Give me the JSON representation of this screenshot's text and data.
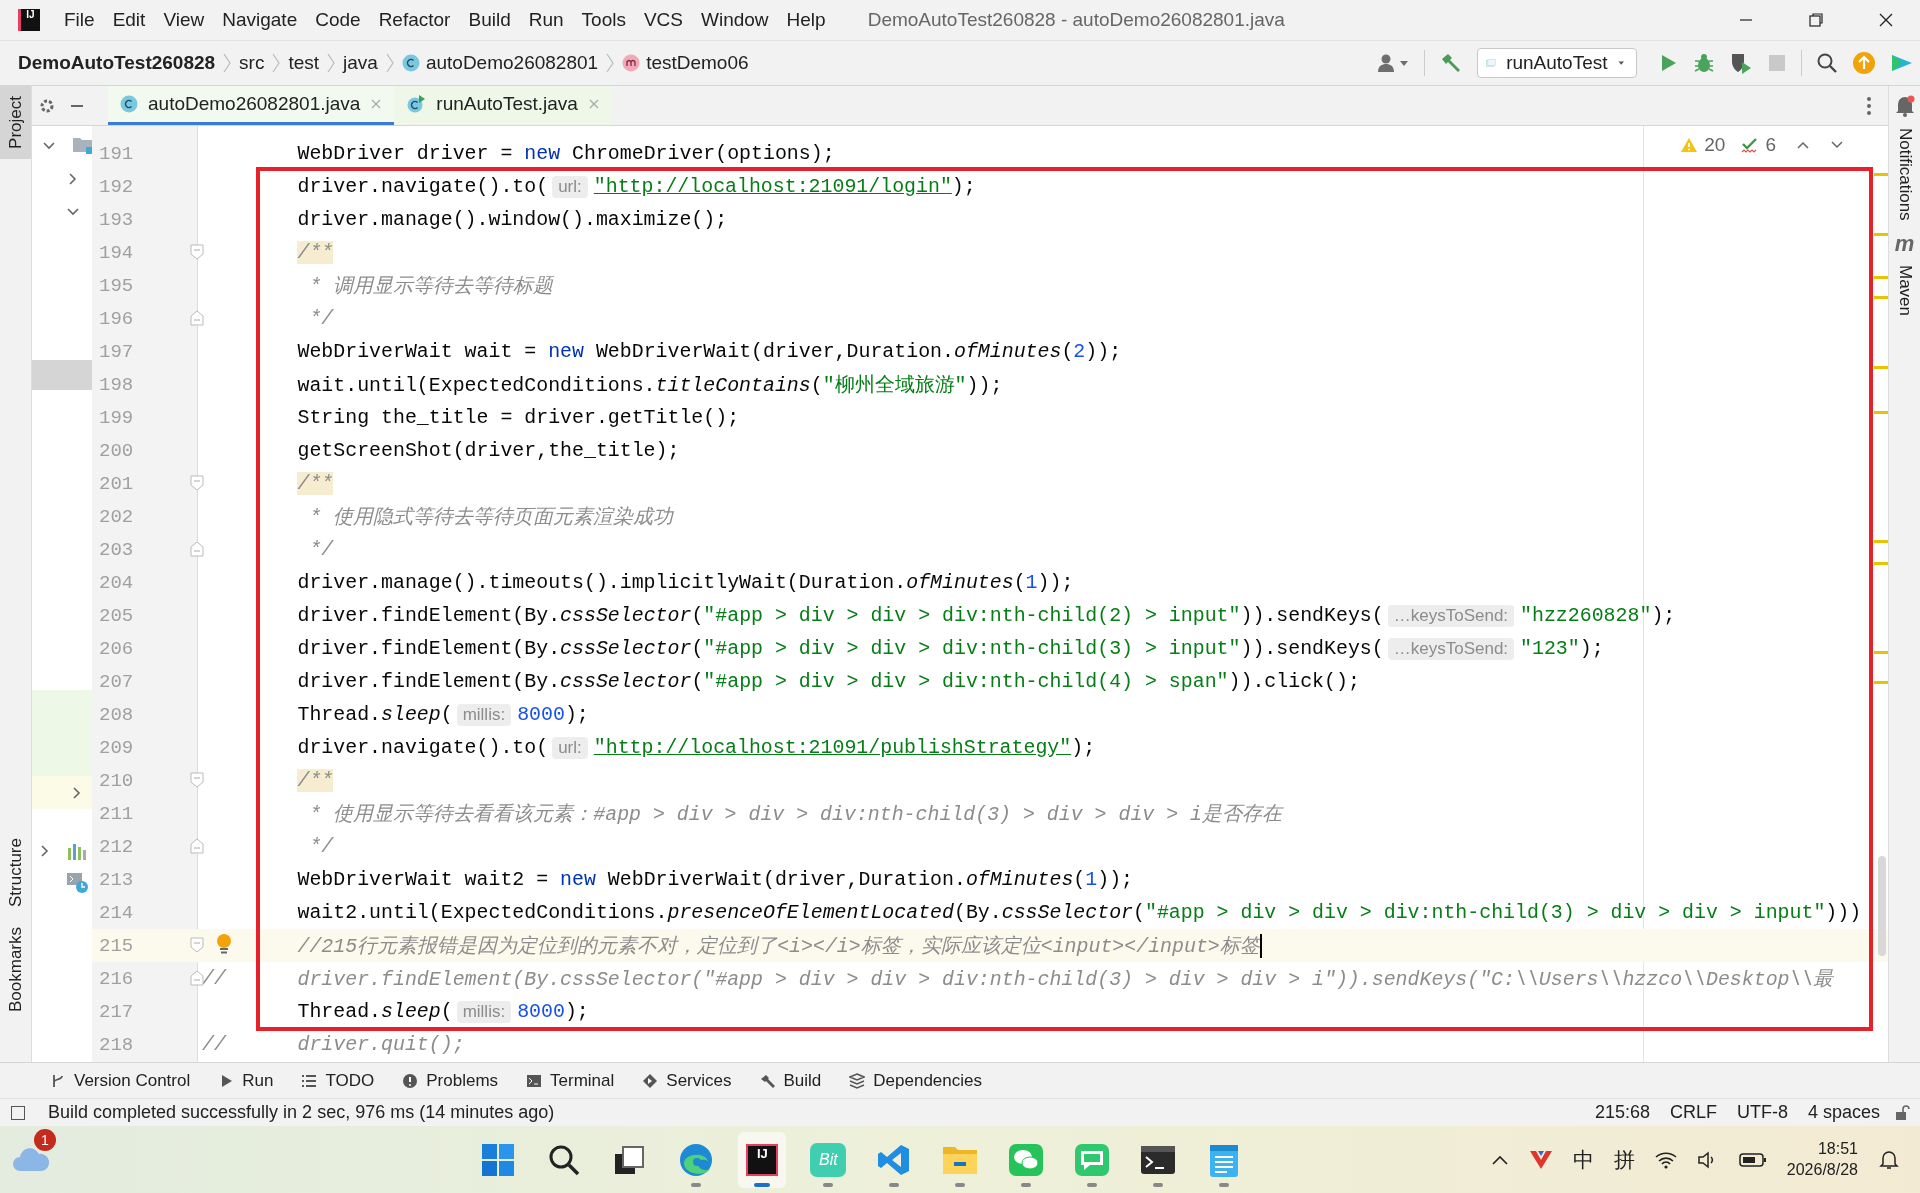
{
  "window": {
    "logo_text": "IJ",
    "title": "DemoAutoTest260828 - autoDemo26082801.java"
  },
  "menu": [
    "File",
    "Edit",
    "View",
    "Navigate",
    "Code",
    "Refactor",
    "Build",
    "Run",
    "Tools",
    "VCS",
    "Window",
    "Help"
  ],
  "breadcrumbs": [
    {
      "label": "DemoAutoTest260828",
      "kind": "project"
    },
    {
      "label": "src",
      "kind": "folder"
    },
    {
      "label": "test",
      "kind": "folder"
    },
    {
      "label": "java",
      "kind": "folder"
    },
    {
      "label": "autoDemo26082801",
      "kind": "class"
    },
    {
      "label": "testDemo06",
      "kind": "method"
    }
  ],
  "run_config": {
    "label": "runAutoTest"
  },
  "side_tabs_left": [
    {
      "label": "Project",
      "selected": true
    },
    {
      "label": "Structure",
      "selected": false
    },
    {
      "label": "Bookmarks",
      "selected": false
    }
  ],
  "side_tabs_right": [
    {
      "label": "Notifications"
    },
    {
      "label": "Maven",
      "icon_text": "m"
    }
  ],
  "project_tree": [
    {
      "expanded": true
    },
    {
      "expanded": false
    },
    {
      "expanded": true
    }
  ],
  "tabs": [
    {
      "label": "autoDemo26082801.java",
      "selected": true,
      "kind": "class"
    },
    {
      "label": "runAutoTest.java",
      "selected": false,
      "kind": "runnable"
    }
  ],
  "inspections": {
    "warnings": "20",
    "weak_warnings": "6"
  },
  "editor": {
    "lines": [
      {
        "number": "191",
        "segments": [
          {
            "kind": "plain",
            "text": "WebDriver driver = "
          },
          {
            "kind": "keyword",
            "text": "new"
          },
          {
            "kind": "plain",
            "text": " ChromeDriver(options);"
          }
        ]
      },
      {
        "number": "192",
        "segments": [
          {
            "kind": "plain",
            "text": "driver.navigate().to("
          },
          {
            "kind": "hint",
            "text": "url:"
          },
          {
            "kind": "link",
            "text": "\"http://localhost:21091/login\""
          },
          {
            "kind": "plain",
            "text": ");"
          }
        ]
      },
      {
        "number": "193",
        "segments": [
          {
            "kind": "plain",
            "text": "driver.manage().window().maximize();"
          }
        ]
      },
      {
        "number": "194",
        "fold_start": true,
        "segments": [
          {
            "kind": "doc-warn",
            "text": "/**"
          }
        ]
      },
      {
        "number": "195",
        "segments": [
          {
            "kind": "doc",
            "text": " * 调用显示等待去等待标题"
          }
        ]
      },
      {
        "number": "196",
        "fold_end": true,
        "segments": [
          {
            "kind": "doc",
            "text": " */"
          }
        ]
      },
      {
        "number": "197",
        "segments": [
          {
            "kind": "plain",
            "text": "WebDriverWait wait = "
          },
          {
            "kind": "keyword",
            "text": "new"
          },
          {
            "kind": "plain",
            "text": " WebDriverWait(driver,Duration."
          },
          {
            "kind": "method",
            "text": "ofMinutes"
          },
          {
            "kind": "plain",
            "text": "("
          },
          {
            "kind": "number",
            "text": "2"
          },
          {
            "kind": "plain",
            "text": "));"
          }
        ]
      },
      {
        "number": "198",
        "segments": [
          {
            "kind": "plain",
            "text": "wait.until(ExpectedConditions."
          },
          {
            "kind": "method",
            "text": "titleContains"
          },
          {
            "kind": "plain",
            "text": "("
          },
          {
            "kind": "string",
            "text": "\"柳州全域旅游\""
          },
          {
            "kind": "plain",
            "text": "));"
          }
        ]
      },
      {
        "number": "199",
        "segments": [
          {
            "kind": "plain",
            "text": "String the_title = driver.getTitle();"
          }
        ]
      },
      {
        "number": "200",
        "segments": [
          {
            "kind": "plain",
            "text": "getScreenShot(driver,the_title);"
          }
        ]
      },
      {
        "number": "201",
        "fold_start": true,
        "segments": [
          {
            "kind": "doc-warn",
            "text": "/**"
          }
        ]
      },
      {
        "number": "202",
        "segments": [
          {
            "kind": "doc",
            "text": " * 使用隐式等待去等待页面元素渲染成功"
          }
        ]
      },
      {
        "number": "203",
        "fold_end": true,
        "segments": [
          {
            "kind": "doc",
            "text": " */"
          }
        ]
      },
      {
        "number": "204",
        "segments": [
          {
            "kind": "plain",
            "text": "driver.manage().timeouts().implicitlyWait(Duration."
          },
          {
            "kind": "method",
            "text": "ofMinutes"
          },
          {
            "kind": "plain",
            "text": "("
          },
          {
            "kind": "number",
            "text": "1"
          },
          {
            "kind": "plain",
            "text": "));"
          }
        ]
      },
      {
        "number": "205",
        "segments": [
          {
            "kind": "plain",
            "text": "driver.findElement(By."
          },
          {
            "kind": "method",
            "text": "cssSelector"
          },
          {
            "kind": "plain",
            "text": "("
          },
          {
            "kind": "string",
            "text": "\"#app > div > div > div:nth-child(2) > input\""
          },
          {
            "kind": "plain",
            "text": ")).sendKeys("
          },
          {
            "kind": "hint",
            "text": "…keysToSend:"
          },
          {
            "kind": "string",
            "text": "\"hzz260828\""
          },
          {
            "kind": "plain",
            "text": ");"
          }
        ]
      },
      {
        "number": "206",
        "segments": [
          {
            "kind": "plain",
            "text": "driver.findElement(By."
          },
          {
            "kind": "method",
            "text": "cssSelector"
          },
          {
            "kind": "plain",
            "text": "("
          },
          {
            "kind": "string",
            "text": "\"#app > div > div > div:nth-child(3) > input\""
          },
          {
            "kind": "plain",
            "text": ")).sendKeys("
          },
          {
            "kind": "hint",
            "text": "…keysToSend:"
          },
          {
            "kind": "string",
            "text": "\"123\""
          },
          {
            "kind": "plain",
            "text": ");"
          }
        ]
      },
      {
        "number": "207",
        "segments": [
          {
            "kind": "plain",
            "text": "driver.findElement(By."
          },
          {
            "kind": "method",
            "text": "cssSelector"
          },
          {
            "kind": "plain",
            "text": "("
          },
          {
            "kind": "string",
            "text": "\"#app > div > div > div:nth-child(4) > span\""
          },
          {
            "kind": "plain",
            "text": ")).click();"
          }
        ]
      },
      {
        "number": "208",
        "segments": [
          {
            "kind": "plain",
            "text": "Thread."
          },
          {
            "kind": "method",
            "text": "sleep"
          },
          {
            "kind": "plain",
            "text": "("
          },
          {
            "kind": "hint",
            "text": "millis:"
          },
          {
            "kind": "number",
            "text": "8000"
          },
          {
            "kind": "plain",
            "text": ");"
          }
        ]
      },
      {
        "number": "209",
        "segments": [
          {
            "kind": "plain",
            "text": "driver.navigate().to("
          },
          {
            "kind": "hint",
            "text": "url:"
          },
          {
            "kind": "link",
            "text": "\"http://localhost:21091/publishStrategy\""
          },
          {
            "kind": "plain",
            "text": ");"
          }
        ]
      },
      {
        "number": "210",
        "fold_start": true,
        "segments": [
          {
            "kind": "doc-warn",
            "text": "/**"
          }
        ]
      },
      {
        "number": "211",
        "segments": [
          {
            "kind": "doc",
            "text": " * 使用显示等待去看看该元素：#app > div > div > div:nth-child(3) > div > div > i是否存在"
          }
        ]
      },
      {
        "number": "212",
        "fold_end": true,
        "segments": [
          {
            "kind": "doc",
            "text": " */"
          }
        ]
      },
      {
        "number": "213",
        "segments": [
          {
            "kind": "plain",
            "text": "WebDriverWait wait2 = "
          },
          {
            "kind": "keyword",
            "text": "new"
          },
          {
            "kind": "plain",
            "text": " WebDriverWait(driver,Duration."
          },
          {
            "kind": "method",
            "text": "ofMinutes"
          },
          {
            "kind": "plain",
            "text": "("
          },
          {
            "kind": "number",
            "text": "1"
          },
          {
            "kind": "plain",
            "text": "));"
          }
        ]
      },
      {
        "number": "214",
        "segments": [
          {
            "kind": "plain",
            "text": "wait2.until(ExpectedConditions."
          },
          {
            "kind": "method",
            "text": "presenceOfElementLocated"
          },
          {
            "kind": "plain",
            "text": "(By."
          },
          {
            "kind": "method",
            "text": "cssSelector"
          },
          {
            "kind": "plain",
            "text": "("
          },
          {
            "kind": "string",
            "text": "\"#app > div > div > div:nth-child(3) > div > div > input\""
          },
          {
            "kind": "plain",
            "text": ")))"
          }
        ]
      },
      {
        "number": "215",
        "fold_start": true,
        "current": true,
        "intention": true,
        "segments": [
          {
            "kind": "comment",
            "text": "//215行元素报错是因为定位到的元素不对，定位到了<i></i>标签，实际应该定位<input></input>标签"
          }
        ]
      },
      {
        "number": "216",
        "fold_end": true,
        "prefix": "//",
        "segments": [
          {
            "kind": "comment",
            "text": "driver.findElement(By.cssSelector(\"#app > div > div > div:nth-child(3) > div > div > i\")).sendKeys(\"C:\\\\Users\\\\hzzco\\\\Desktop\\\\最"
          }
        ]
      },
      {
        "number": "217",
        "segments": [
          {
            "kind": "plain",
            "text": "Thread."
          },
          {
            "kind": "method",
            "text": "sleep"
          },
          {
            "kind": "plain",
            "text": "("
          },
          {
            "kind": "hint",
            "text": "millis:"
          },
          {
            "kind": "number",
            "text": "8000"
          },
          {
            "kind": "plain",
            "text": ");"
          }
        ]
      },
      {
        "number": "218",
        "prefix": "//",
        "segments": [
          {
            "kind": "comment",
            "text": "driver.quit();"
          }
        ]
      }
    ]
  },
  "tool_windows": [
    {
      "label": "Version Control",
      "kind": "vcs"
    },
    {
      "label": "Run",
      "kind": "run"
    },
    {
      "label": "TODO",
      "kind": "todo"
    },
    {
      "label": "Problems",
      "kind": "problems"
    },
    {
      "label": "Terminal",
      "kind": "terminal"
    },
    {
      "label": "Services",
      "kind": "services"
    },
    {
      "label": "Build",
      "kind": "build"
    },
    {
      "label": "Dependencies",
      "kind": "dependencies"
    }
  ],
  "status_bar": {
    "message": "Build completed successfully in 2 sec, 976 ms (14 minutes ago)",
    "position": "215:68",
    "line_ending": "CRLF",
    "encoding": "UTF-8",
    "indent": "4 spaces"
  },
  "taskbar": {
    "weather_badge": "1",
    "apps": [
      {
        "kind": "start",
        "running": false,
        "selected": false
      },
      {
        "kind": "search",
        "running": false,
        "selected": false
      },
      {
        "kind": "taskview",
        "running": false,
        "selected": false
      },
      {
        "kind": "edge",
        "running": true,
        "selected": false
      },
      {
        "kind": "ide",
        "label": "IJ",
        "running": true,
        "selected": true
      },
      {
        "kind": "bit",
        "label": "Bit",
        "running": true,
        "selected": false
      },
      {
        "kind": "vscode",
        "running": true,
        "selected": false
      },
      {
        "kind": "explorer",
        "running": true,
        "selected": false
      },
      {
        "kind": "wechat",
        "running": true,
        "selected": false
      },
      {
        "kind": "chat",
        "running": true,
        "selected": false
      },
      {
        "kind": "terminal",
        "running": true,
        "selected": false
      },
      {
        "kind": "notepad",
        "running": true,
        "selected": false
      }
    ],
    "ime": [
      "中",
      "拼"
    ],
    "time": "18:51",
    "date": "2026/8/28"
  }
}
